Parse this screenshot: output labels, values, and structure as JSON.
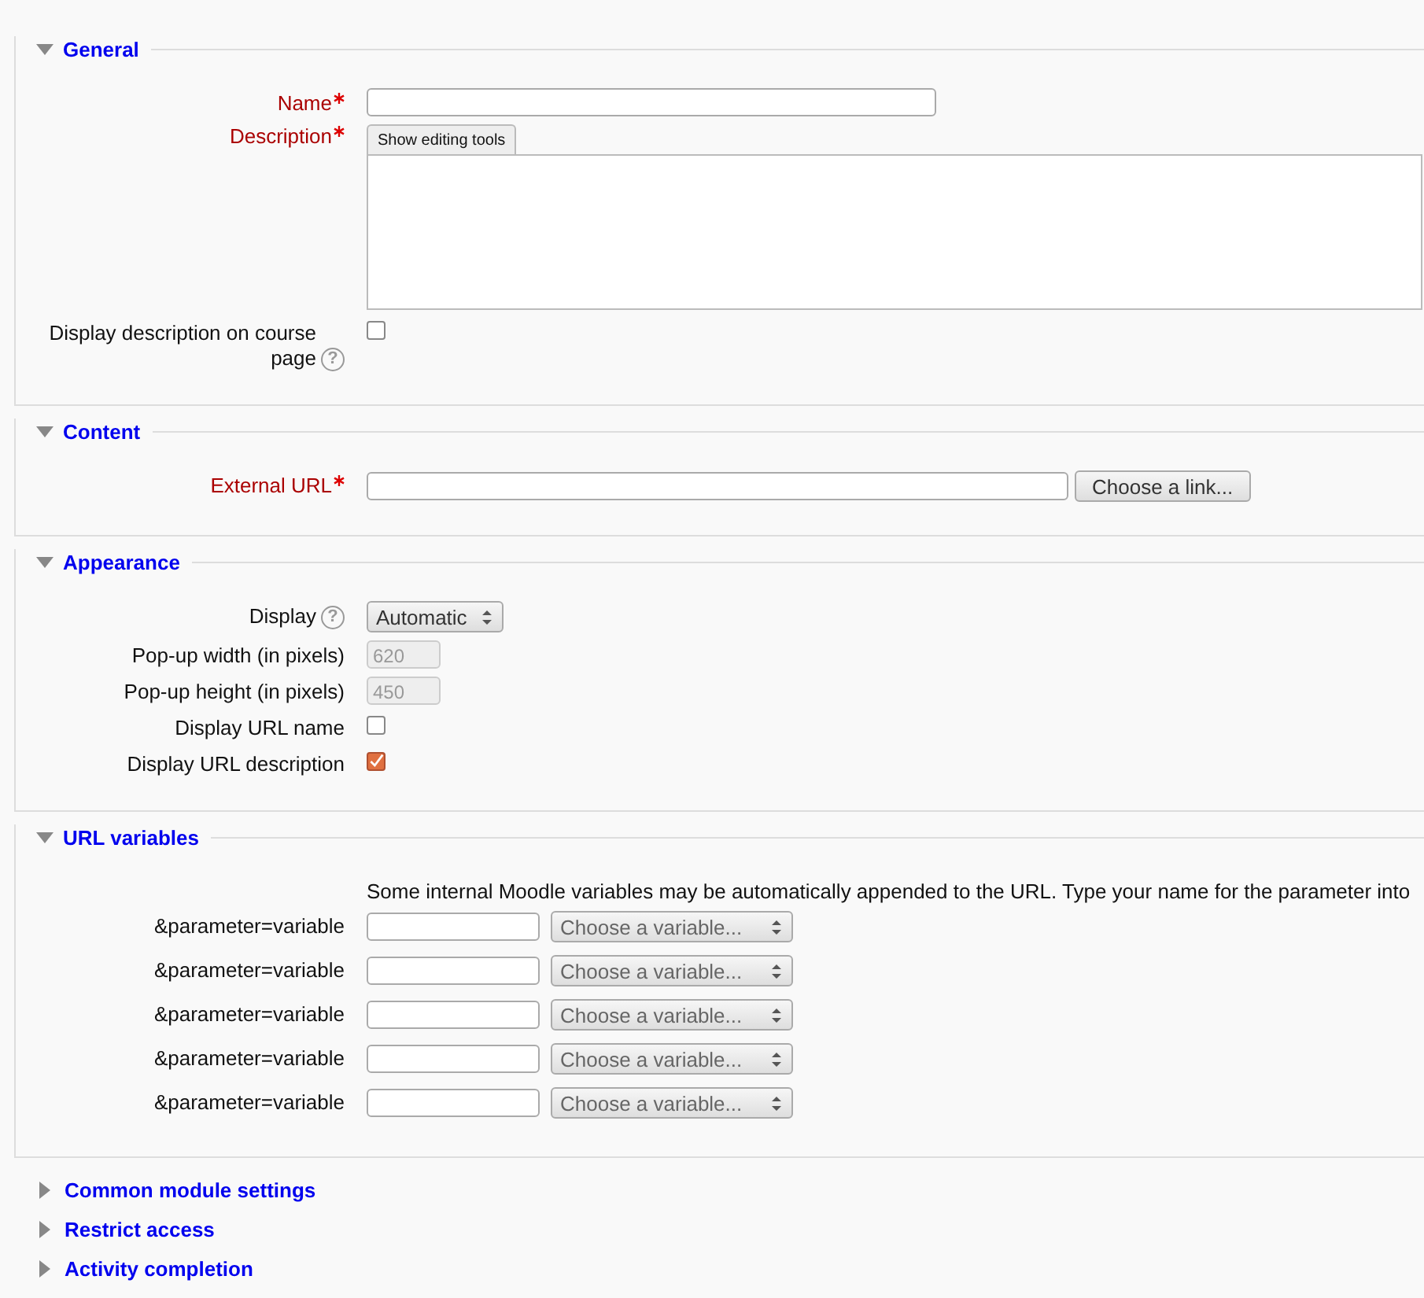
{
  "sections": [
    {
      "title": "General",
      "expanded": true,
      "rows": [
        {
          "kind": "text",
          "label": "Name",
          "required": true
        },
        {
          "kind": "editor",
          "label": "Description",
          "required": true,
          "toolbar_button": "Show editing tools"
        },
        {
          "kind": "checkbox",
          "label": "Display description on course page",
          "help": "?",
          "checked": false
        }
      ]
    },
    {
      "title": "Content",
      "expanded": true,
      "rows": [
        {
          "kind": "url",
          "label": "External URL",
          "required": true,
          "button": "Choose a link..."
        }
      ]
    },
    {
      "title": "Appearance",
      "expanded": true,
      "rows": [
        {
          "kind": "select",
          "label": "Display",
          "help": "?",
          "value": "Automatic"
        },
        {
          "kind": "number",
          "label": "Pop-up width (in pixels)",
          "value": "620",
          "disabled": true
        },
        {
          "kind": "number",
          "label": "Pop-up height (in pixels)",
          "value": "450",
          "disabled": true
        },
        {
          "kind": "checkbox",
          "label": "Display URL name",
          "checked": false
        },
        {
          "kind": "checkbox",
          "label": "Display URL description",
          "checked": true
        }
      ]
    },
    {
      "title": "URL variables",
      "expanded": true,
      "rows": [
        {
          "kind": "info",
          "text": "Some internal Moodle variables may be automatically appended to the URL. Type your name for the parameter into"
        },
        {
          "kind": "param",
          "label": "&parameter=variable",
          "select": "Choose a variable..."
        },
        {
          "kind": "param",
          "label": "&parameter=variable",
          "select": "Choose a variable..."
        },
        {
          "kind": "param",
          "label": "&parameter=variable",
          "select": "Choose a variable..."
        },
        {
          "kind": "param",
          "label": "&parameter=variable",
          "select": "Choose a variable..."
        },
        {
          "kind": "param",
          "label": "&parameter=variable",
          "select": "Choose a variable..."
        }
      ]
    },
    {
      "title": "Common module settings",
      "expanded": false
    },
    {
      "title": "Restrict access",
      "expanded": false
    },
    {
      "title": "Activity completion",
      "expanded": false
    }
  ]
}
